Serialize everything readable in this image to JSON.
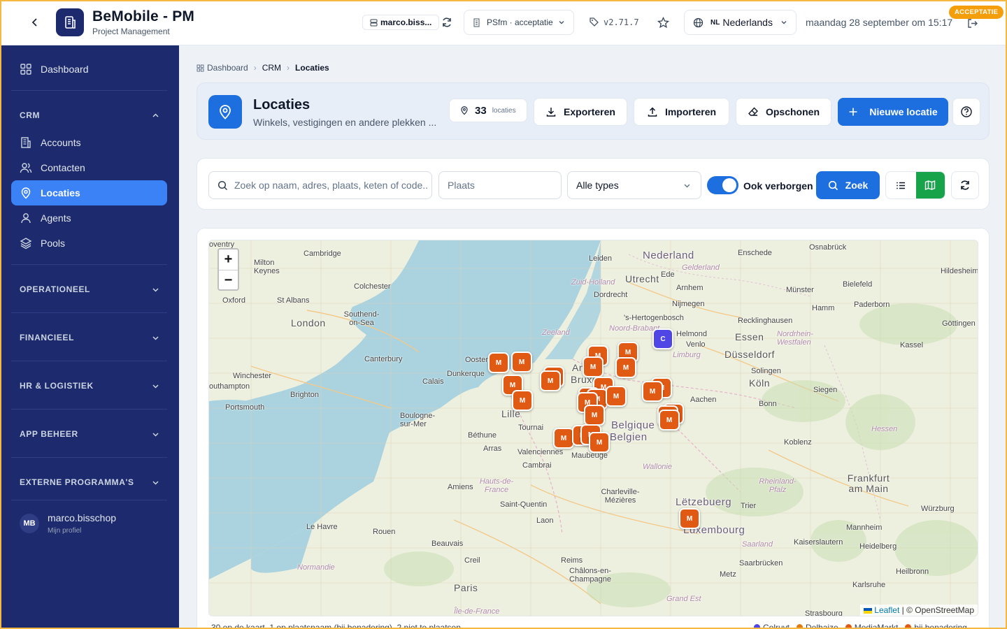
{
  "app": {
    "title": "BeMobile - PM",
    "subtitle": "Project Management"
  },
  "topbar": {
    "user": "marco.biss...",
    "environment": "PSfm · acceptatie",
    "version": "v2.71.7",
    "language_code": "NL",
    "language": "Nederlands",
    "datetime": "maandag 28 september om 15:17",
    "env_badge": "ACCEPTATIE"
  },
  "sidebar": {
    "dashboard": "Dashboard",
    "crm_section": "CRM",
    "crm_items": [
      "Accounts",
      "Contacten",
      "Locaties",
      "Agents",
      "Pools"
    ],
    "active_item": "Locaties",
    "sections": [
      "OPERATIONEEL",
      "FINANCIEEL",
      "HR & LOGISTIEK",
      "APP BEHEER",
      "EXTERNE PROGRAMMA'S"
    ],
    "profile": {
      "initials": "MB",
      "name": "marco.bisschop",
      "link": "Mijn profiel"
    }
  },
  "breadcrumb": [
    "Dashboard",
    "CRM",
    "Locaties"
  ],
  "header": {
    "title": "Locaties",
    "subtitle": "Winkels, vestigingen en andere plekken ...",
    "count": "33",
    "count_label": "locaties",
    "export": "Exporteren",
    "import": "Importeren",
    "cleanup": "Opschonen",
    "new": "Nieuwe locatie"
  },
  "filters": {
    "search_placeholder": "Zoek op naam, adres, plaats, keten of code..",
    "place_placeholder": "Plaats",
    "type_value": "Alle types",
    "show_hidden_label": "Ook verborgen",
    "show_hidden": true,
    "search_button": "Zoek"
  },
  "map": {
    "zoom_in": "+",
    "zoom_out": "−",
    "attribution_leaflet": "Leaflet",
    "attribution_osm": "| © OpenStreetMap",
    "marker_letter_m": "M",
    "marker_letter_c": "C",
    "labels": {
      "nederland": "Nederland",
      "gelderland": "Gelderland",
      "utrecht": "Utrecht",
      "leiden": "Leiden",
      "zuid_holland": "Zuid-Holland",
      "dordrecht": "Dordrecht",
      "arnhem": "Arnhem",
      "nijmegen": "Nijmegen",
      "ede": "Ede",
      "enschede": "Enschede",
      "osnabruck": "Osnabrück",
      "bielefeld": "Bielefeld",
      "munster": "Münster",
      "hamm": "Hamm",
      "paderborn": "Paderborn",
      "hildesheim": "Hildesheim",
      "gottingen": "Göttingen",
      "kassel": "Kassel",
      "recklinghausen": "Recklinghausen",
      "essen": "Essen",
      "nrw": "Nordrhein-Westfalen",
      "dusseldorf": "Düsseldorf",
      "solingen": "Solingen",
      "koln": "Köln",
      "bonn": "Bonn",
      "siegen": "Siegen",
      "aachen": "Aachen",
      "hertogenbosch": "'s-Hertogenbosch",
      "noord_brabant": "Noord-Brabant",
      "helmond": "Helmond",
      "venlo": "Venlo",
      "limburg": "Limburg",
      "zeeland": "Zeeland",
      "oostende": "Oostende",
      "dunkerque": "Dunkerque",
      "calais": "Calais",
      "boulogne": "Boulogne-sur-Mer",
      "lille": "Lille",
      "tournai": "Tournai",
      "bethune": "Béthune",
      "arras": "Arras",
      "valenciennes": "Valenciennes",
      "maubeuge": "Maubeuge",
      "cambrai": "Cambrai",
      "belgique": "Belgique",
      "belgien": "Belgien",
      "wallonie": "Wallonie",
      "charleville": "Charleville-Mézières",
      "amiens": "Amiens",
      "hauts_de_france": "Hauts-de-France",
      "saint_quentin": "Saint-Quentin",
      "laon": "Laon",
      "beauvais": "Beauvais",
      "rouen": "Rouen",
      "le_havre": "Le Havre",
      "normandie": "Normandie",
      "creil": "Creil",
      "reims": "Reims",
      "chalons": "Châlons-en-Champagne",
      "paris": "Paris",
      "ile_de_france": "Île-de-France",
      "grand_est": "Grand Est",
      "metz": "Metz",
      "letzebuerg": "Lëtzebuerg",
      "luxembourg": "Luxembourg",
      "trier": "Trier",
      "saarland": "Saarland",
      "saarbrucken": "Saarbrücken",
      "kaiserslautern": "Kaiserslautern",
      "mannheim": "Mannheim",
      "heidelberg": "Heidelberg",
      "heilbronn": "Heilbronn",
      "karlsruhe": "Karlsruhe",
      "rheinland_pfalz": "Rheinland-Pfalz",
      "koblenz": "Koblenz",
      "hessen": "Hessen",
      "frankfurt": "Frankfurt am Main",
      "wurzburg": "Würzburg",
      "strasbourg": "Strasbourg",
      "cambridge": "Cambridge",
      "milton_keynes": "Milton Keynes",
      "colchester": "Colchester",
      "oxford": "Oxford",
      "st_albans": "St Albans",
      "london": "London",
      "southend": "Southend-on-Sea",
      "canterbury": "Canterbury",
      "winchester": "Winchester",
      "southampton": "outhampton",
      "portsmouth": "Portsmouth",
      "brighton": "Brighton",
      "coventry": "oventry",
      "antwerpen": "An",
      "brussel": "Bruxe"
    }
  },
  "footer": {
    "summary": "30 op de kaart, 1 op plaatsnaam (bij benadering), 2 niet te plaatsen",
    "legend": [
      "Colruyt",
      "Delhaize",
      "MediaMarkt",
      "bij benadering"
    ],
    "legend_colors": [
      "#4f46e5",
      "#e07b14",
      "#e05a14",
      "#e05a14"
    ]
  }
}
